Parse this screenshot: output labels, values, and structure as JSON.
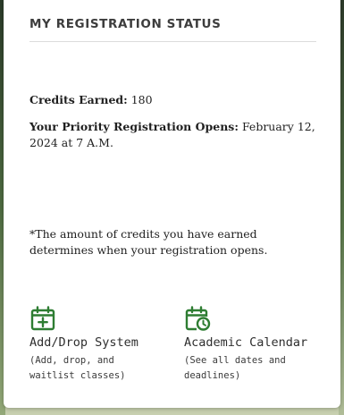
{
  "card": {
    "title": "MY REGISTRATION STATUS",
    "credits_label": "Credits Earned:",
    "credits_value": "180",
    "priority_label": "Your Priority Registration Opens:",
    "priority_value": "February 12, 2024 at 7 A.M.",
    "note": "*The amount of credits you have earned determines when your registration opens."
  },
  "links": [
    {
      "icon": "calendar-plus-icon",
      "title": "Add/Drop System",
      "description": "(Add, drop, and waitlist classes)"
    },
    {
      "icon": "calendar-clock-icon",
      "title": "Academic Calendar",
      "description": "(See all dates and deadlines)"
    }
  ],
  "colors": {
    "icon_green": "#2e7d32",
    "card_bg": "#ffffff",
    "text_dark": "#1f1f1f"
  }
}
